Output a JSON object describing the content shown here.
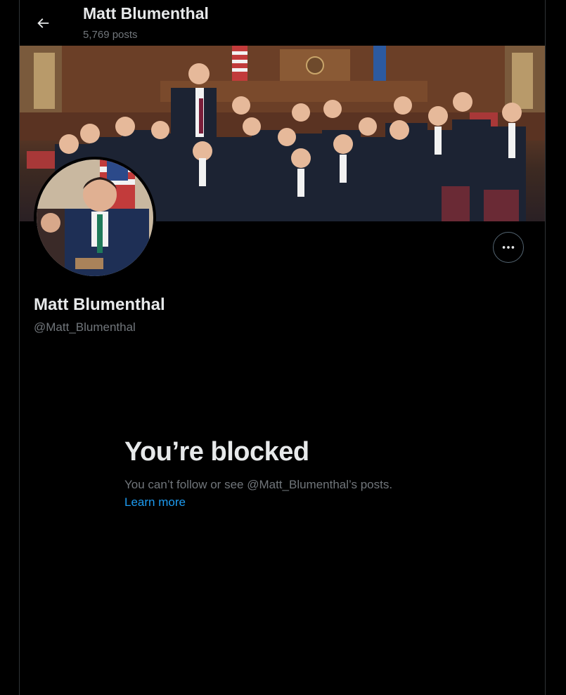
{
  "header": {
    "title": "Matt Blumenthal",
    "post_count": "5,769 posts",
    "back_icon": "arrow-left-icon"
  },
  "banner": {
    "kind": "photo of group of students in school uniforms with a man in a legislative chamber"
  },
  "profile": {
    "name": "Matt Blumenthal",
    "handle": "@Matt_Blumenthal",
    "more_icon": "more-horizontal-icon"
  },
  "blocked": {
    "title": "You’re blocked",
    "description": "You can’t follow or see @Matt_Blumenthal’s posts.",
    "learn_more": "Learn more"
  },
  "colors": {
    "background": "#000000",
    "text_primary": "#e7e9ea",
    "text_secondary": "#71767b",
    "link": "#1d9bf0",
    "border": "#2f3336"
  }
}
